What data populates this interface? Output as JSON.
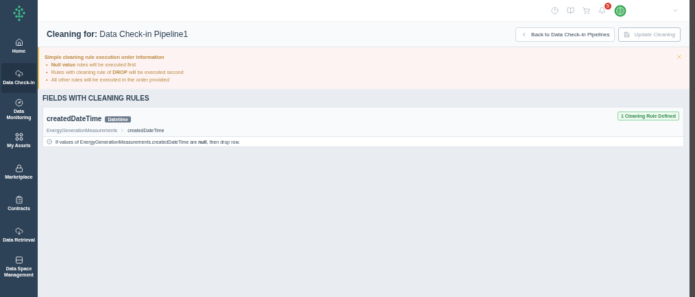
{
  "sidebar": {
    "items": [
      {
        "label": "Home",
        "selected": false
      },
      {
        "label": "Data Check-in",
        "selected": true
      },
      {
        "label": "Data Monitoring",
        "selected": false
      },
      {
        "label": "My Assets",
        "selected": false
      },
      {
        "label": "Marketplace",
        "selected": false
      },
      {
        "label": "Contracts",
        "selected": false
      },
      {
        "label": "Data Retrieval",
        "selected": false
      },
      {
        "label": "Data Space Management",
        "selected": false
      }
    ]
  },
  "topbar": {
    "notifications": "5"
  },
  "header": {
    "label": "Cleaning for:",
    "pipeline": "Data Check-in Pipeline1",
    "buttons": [
      {
        "label": "Back to Data Check-in Pipelines",
        "kind": "back",
        "disabled": false
      },
      {
        "label": "Update Cleaning",
        "kind": "save",
        "disabled": true
      }
    ]
  },
  "alert": {
    "title": "Simple cleaning rule execution order information",
    "bullet": "•",
    "items": [
      "**Null value** rules will be executed first",
      "Rules with cleaning rule of **DROP** will be executed second",
      "All other rules will be executed in the order provided"
    ]
  },
  "section": {
    "title": "FIELDS WITH CLEANING RULES",
    "fields": [
      {
        "name": "createdDateTime",
        "type": "Datetime",
        "status": "1 Cleaning Rule Defined",
        "path": [
          "EnergyGenerationMeasurements",
          "createdDateTime"
        ],
        "rules": [
          "If values of EnergyGenerationMeasurements.createdDateTime are **null**, then drop row."
        ]
      }
    ]
  }
}
